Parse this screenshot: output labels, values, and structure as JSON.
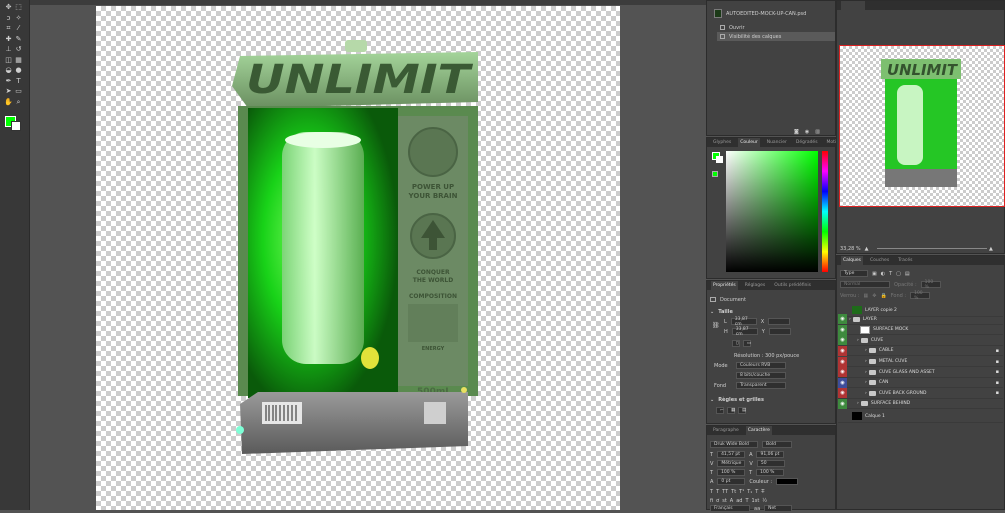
{
  "colors": {
    "foreground": "#00ff00",
    "background": "#ffffff",
    "eye_red": "#b03434",
    "eye_green": "#3e8a3e",
    "eye_blue": "#3e4d9a"
  },
  "tools": [
    "move-icon",
    "marquee-icon",
    "lasso-icon",
    "magic-wand-icon",
    "crop-icon",
    "eyedropper-icon",
    "healing-icon",
    "brush-icon",
    "stamp-icon",
    "history-brush-icon",
    "eraser-icon",
    "gradient-icon",
    "blur-icon",
    "dodge-icon",
    "pen-icon",
    "type-icon",
    "path-select-icon",
    "shape-icon",
    "hand-icon",
    "zoom-icon"
  ],
  "artwork": {
    "brand": "UNLIMIT",
    "tagline_1": "POWER UP",
    "tagline_2": "YOUR BRAIN",
    "tagline_3": "CONQUER",
    "tagline_4": "THE WORLD",
    "section": "COMPOSITION",
    "section_2": "ENERGY",
    "volume": "500mL"
  },
  "history": {
    "file": "AUTOEDITED-MOCK-UP-CAN.psd",
    "items": [
      "Ouvrir",
      "Visibilité des calques"
    ]
  },
  "navigator": {
    "zoom": "33,28 %"
  },
  "color_panel": {
    "tabs": [
      "Glyphes",
      "Couleur",
      "Nuancier",
      "Dégradés",
      "Motifs"
    ],
    "active": 1
  },
  "properties": {
    "tabs": [
      "Propriétés",
      "Réglages",
      "Outils prédéfinis"
    ],
    "doc_label": "Document",
    "size_label": "Taille",
    "w_label": "L",
    "w_value": "33,87 cm",
    "h_label": "H",
    "h_value": "33,87 cm",
    "x_label": "X",
    "y_label": "Y",
    "resolution": "Résolution : 300 px/pouce",
    "mode_label": "Mode",
    "mode_value": "Couleurs RVB",
    "bits_value": "8 bits/couche",
    "bg_label": "Fond",
    "bg_value": "Transparent",
    "rulers_label": "Règles et grilles"
  },
  "character": {
    "tabs": [
      "Paragraphe",
      "Caractère"
    ],
    "font": "Druk Wide Bold",
    "style": "Bold",
    "size": "41,57 pt",
    "leading": "91,06 pt",
    "kerning": "Métrique",
    "tracking": "50",
    "vscale": "100 %",
    "hscale": "100 %",
    "baseline": "0 pt",
    "color_label": "Couleur :",
    "lang": "Français",
    "aa": "Net",
    "aa_label": "aa",
    "styles": [
      "T",
      "T",
      "TT",
      "Tt",
      "T¹",
      "T₁",
      "T",
      "T̶"
    ],
    "opentype": [
      "fi",
      "ơ",
      "st",
      "A",
      "ad",
      "T",
      "1st",
      "½"
    ]
  },
  "layers": {
    "tabs": [
      "Calques",
      "Couches",
      "Tracés"
    ],
    "filter": "Type",
    "blend": "Normal",
    "opacity_label": "Opacité :",
    "opacity": "100 %",
    "lock_label": "Verrou :",
    "fill_label": "Fond :",
    "fill": "100 %",
    "items": [
      {
        "name": "LAYER copie 2",
        "type": "thumb-green",
        "eye": "none",
        "indent": 0
      },
      {
        "name": "LAYER",
        "type": "folder",
        "eye": "green",
        "indent": 0
      },
      {
        "name": "SURFACE MOCK",
        "type": "smart",
        "eye": "green",
        "indent": 1
      },
      {
        "name": "CUVE",
        "type": "folder",
        "eye": "green",
        "indent": 1
      },
      {
        "name": "CABLE",
        "type": "folder",
        "eye": "red",
        "indent": 2
      },
      {
        "name": "METAL CUVE",
        "type": "folder",
        "eye": "red",
        "indent": 2
      },
      {
        "name": "CUVE GLASS AND ASSET",
        "type": "folder",
        "eye": "red",
        "indent": 2
      },
      {
        "name": "CAN",
        "type": "folder",
        "eye": "blue",
        "indent": 2
      },
      {
        "name": "CUVE BACK GROUND",
        "type": "folder",
        "eye": "red",
        "indent": 2
      },
      {
        "name": "SURFACE BEHIND",
        "type": "folder",
        "eye": "green",
        "indent": 1
      },
      {
        "name": "Calque 1",
        "type": "thumb-black",
        "eye": "none",
        "indent": 0
      }
    ]
  }
}
